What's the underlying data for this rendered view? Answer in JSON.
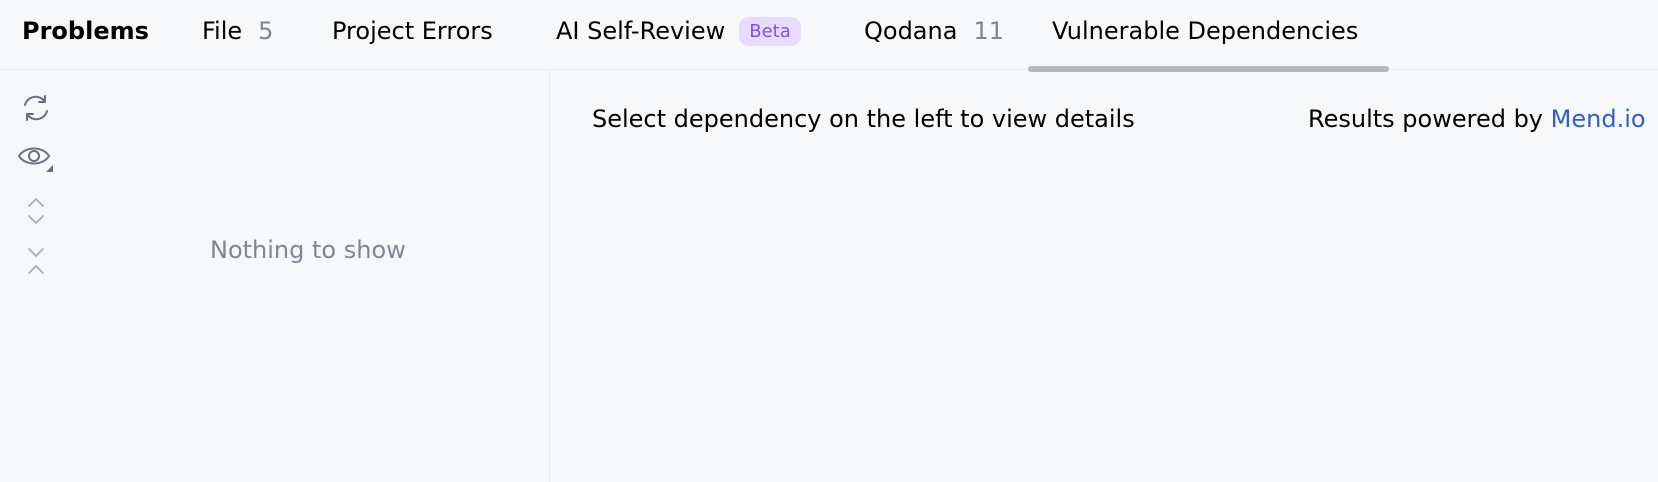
{
  "tabs": {
    "title": "Problems",
    "file": {
      "label": "File",
      "count": "5"
    },
    "project_errors": {
      "label": "Project Errors"
    },
    "ai_self_review": {
      "label": "AI Self-Review",
      "badge": "Beta"
    },
    "qodana": {
      "label": "Qodana",
      "count": "11"
    },
    "vulnerable_dependencies": {
      "label": "Vulnerable Dependencies",
      "selected": true
    }
  },
  "toolbar": {
    "icons": [
      "refresh-icon",
      "eye-options-icon",
      "expand-all-icon",
      "collapse-all-icon"
    ]
  },
  "left_pane": {
    "empty_text": "Nothing to show"
  },
  "details": {
    "hint": "Select dependency on the left to view details",
    "powered_prefix": "Results powered by",
    "powered_link": "Mend.io"
  },
  "colors": {
    "background": "#f7f8fa",
    "badge_bg": "#e7dcfd",
    "badge_text": "#834df0",
    "link": "#2f5fc9",
    "muted_text": "#818594",
    "selected_underline": "#b4b8bf"
  }
}
